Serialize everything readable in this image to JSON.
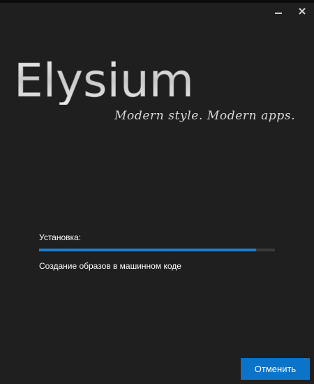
{
  "window": {
    "controls": {
      "minimize_icon": "minimize-icon",
      "close_icon": "close-icon"
    }
  },
  "branding": {
    "logo": "Elysium",
    "tagline": "Modern style. Modern apps."
  },
  "install": {
    "label": "Установка:",
    "progress": 0.92,
    "detail": "Создание образов в машинном коде"
  },
  "buttons": {
    "cancel": "Отменить"
  },
  "colors": {
    "background": "#1f1f1f",
    "accent": "#0c74c8",
    "progress_fill": "#1a7fd0",
    "progress_track": "#3a3a3a"
  }
}
